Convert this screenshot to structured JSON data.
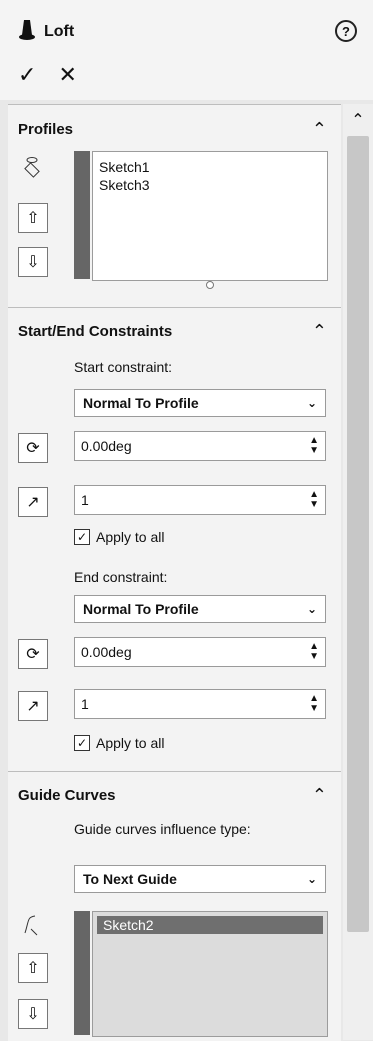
{
  "header": {
    "title": "Loft",
    "help_icon": "question-icon",
    "ok_icon": "checkmark-icon",
    "cancel_icon": "close-icon",
    "help_glyph": "?",
    "ok_glyph": "✓",
    "cancel_glyph": "✕"
  },
  "profiles": {
    "title": "Profiles",
    "items": [
      "Sketch1",
      "Sketch3"
    ],
    "move_up_icon": "arrow-up-icon",
    "move_down_icon": "arrow-down-icon"
  },
  "start_end": {
    "title": "Start/End Constraints",
    "start_label": "Start constraint:",
    "start_value": "Normal To Profile",
    "start_angle": "0.00deg",
    "start_length": "1",
    "start_apply": "Apply to all",
    "end_label": "End constraint:",
    "end_value": "Normal To Profile",
    "end_angle": "0.00deg",
    "end_length": "1",
    "end_apply": "Apply to all"
  },
  "guide": {
    "title": "Guide Curves",
    "influence_label": "Guide curves influence type:",
    "influence_value": "To Next Guide",
    "items": [
      "Sketch2"
    ]
  },
  "colors": {
    "panel_bg": "#f3f3f3",
    "scroll_thumb": "#c7c7c7",
    "list_selected": "#6f6f6f"
  }
}
